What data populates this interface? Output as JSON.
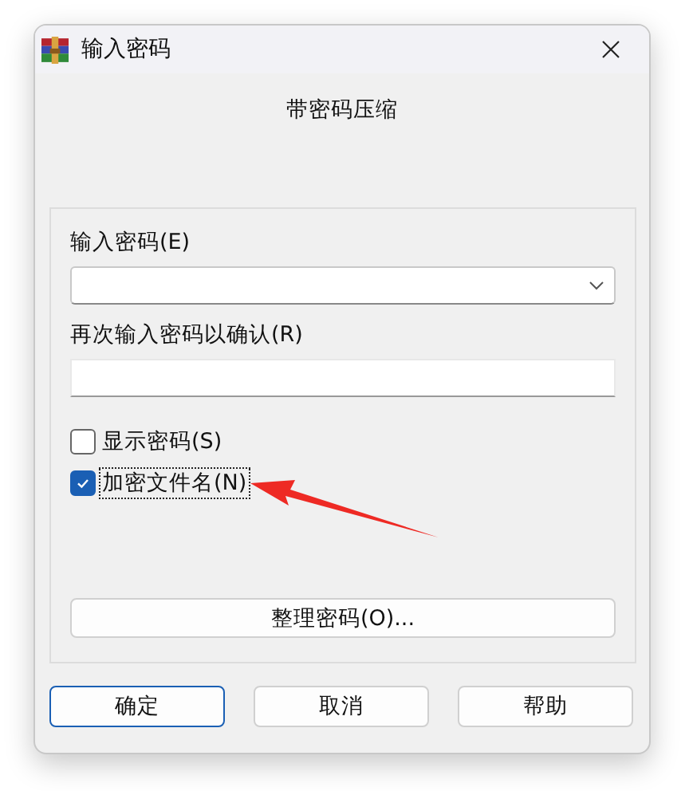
{
  "window": {
    "title": "输入密码"
  },
  "heading": "带密码压缩",
  "fields": [
    {
      "label": "输入密码(E)",
      "kind": "combo"
    },
    {
      "label": "再次输入密码以确认(R)",
      "kind": "text"
    }
  ],
  "checkboxes": [
    {
      "label": "显示密码(S)",
      "checked": false,
      "focused": false
    },
    {
      "label": "加密文件名(N)",
      "checked": true,
      "focused": true
    }
  ],
  "organize_button": "整理密码(O)...",
  "buttons": [
    {
      "label": "确定",
      "default": true
    },
    {
      "label": "取消",
      "default": false
    },
    {
      "label": "帮助",
      "default": false
    }
  ],
  "annotation": {
    "kind": "arrow"
  }
}
